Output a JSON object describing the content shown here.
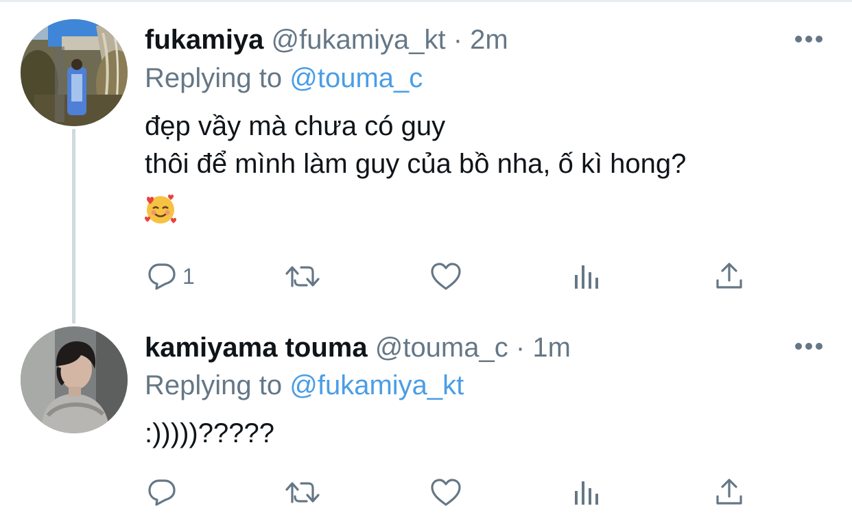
{
  "tweets": [
    {
      "display_name": "fukamiya",
      "handle": "@fukamiya_kt",
      "separator": "·",
      "time": "2m",
      "replying_prefix": "Replying to",
      "replying_to": "@touma_c",
      "text_lines": [
        "đẹp vầy mà chưa có guy",
        "thôi để mình làm guy của bồ nha, ố kì hong?"
      ],
      "emoji": "🥰",
      "reply_count": "1",
      "avatar_icon": "profile-photo-outdoor-plants"
    },
    {
      "display_name": "kamiyama touma",
      "handle": "@touma_c",
      "separator": "·",
      "time": "1m",
      "replying_prefix": "Replying to",
      "replying_to": "@fukamiya_kt",
      "text_lines": [
        ":)))))?????"
      ],
      "reply_count": "",
      "avatar_icon": "profile-photo-person"
    }
  ],
  "icons": {
    "reply": "reply-icon",
    "retweet": "retweet-icon",
    "like": "like-icon",
    "stats": "stats-icon",
    "share": "share-icon",
    "more": "more-icon"
  },
  "colors": {
    "text": "#0f1419",
    "secondary": "#657786",
    "mention": "#4a9de6",
    "thread_line": "#cfd9de"
  }
}
